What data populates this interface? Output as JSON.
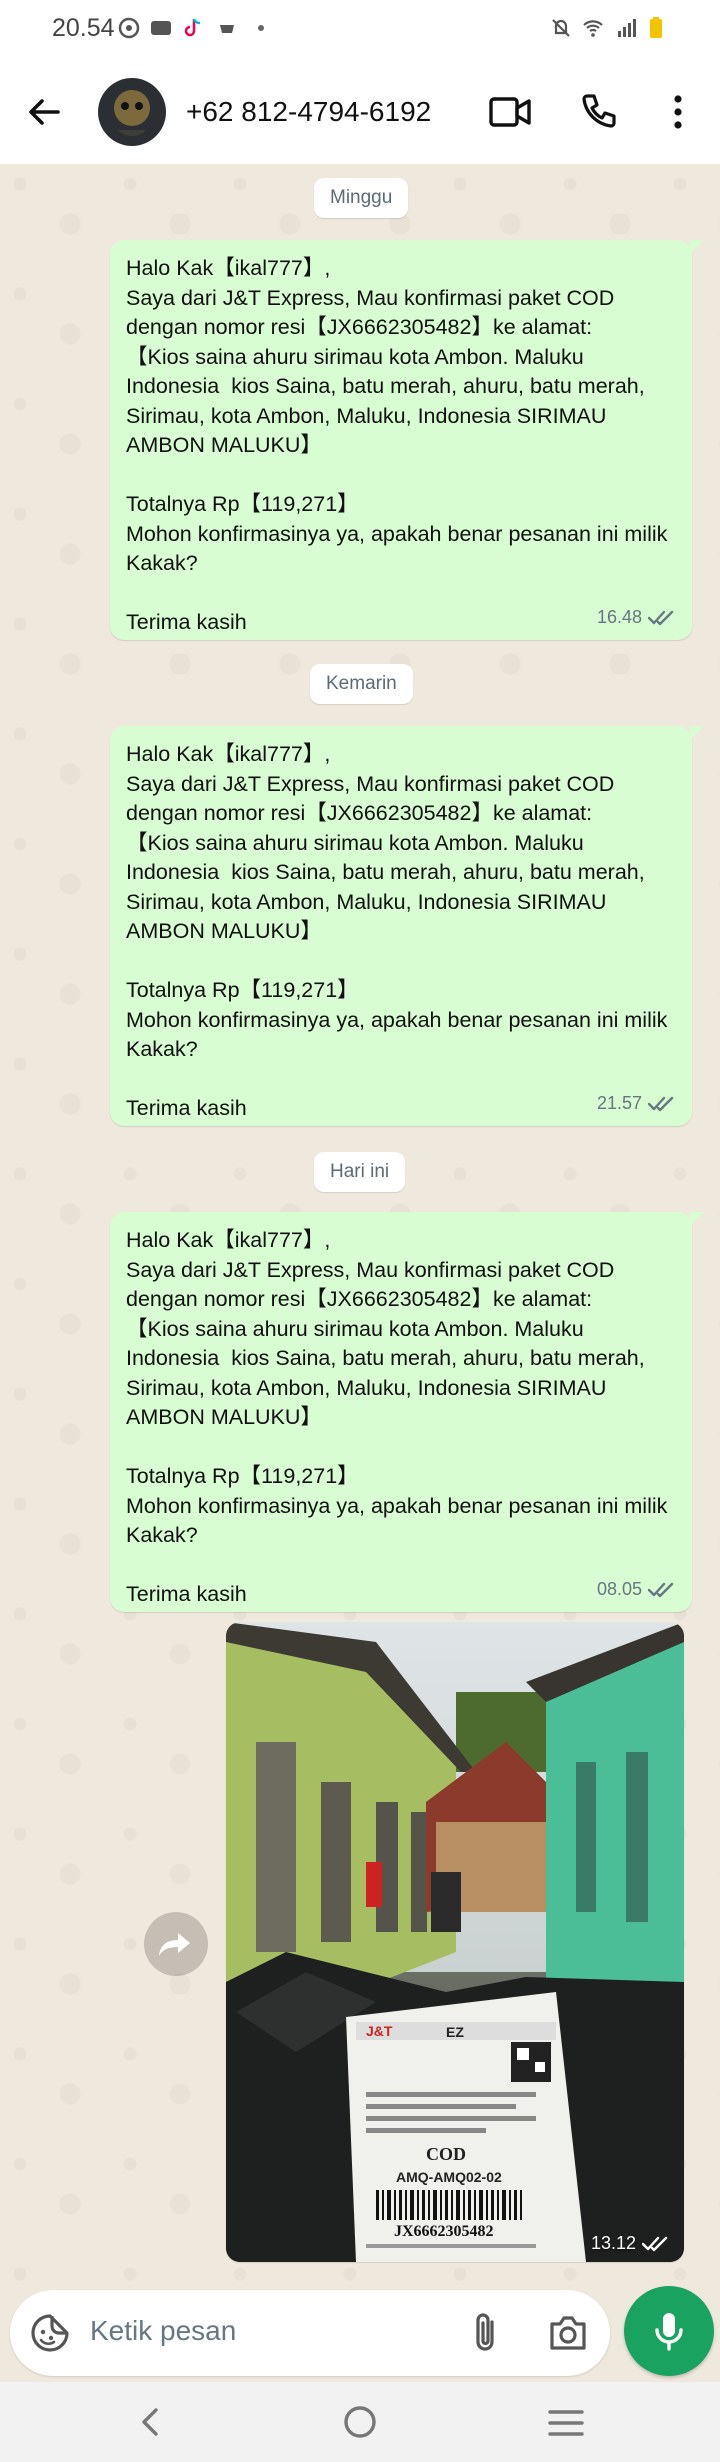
{
  "status_bar": {
    "time": "20.54",
    "icons": [
      "whatsapp-icon",
      "notification-icon",
      "tiktok-icon",
      "game-icon",
      "dot-icon",
      "mute-icon",
      "wifi-icon",
      "signal-icon",
      "battery-icon"
    ]
  },
  "header": {
    "contact_name": "+62 812-4794-6192",
    "actions": [
      "video-call-icon",
      "phone-call-icon",
      "more-options-icon"
    ]
  },
  "chat": {
    "messages": [
      {
        "day_label": "Minggu",
        "text": "Halo Kak【ikal777】,\nSaya dari J&T Express, Mau konfirmasi paket COD dengan nomor resi【JX6662305482】ke alamat:\n【Kios saina ahuru sirimau kota Ambon. Maluku Indonesia  kios Saina, batu merah, ahuru, batu merah, Sirimau, kota Ambon, Maluku, Indonesia SIRIMAU AMBON MALUKU】\n\nTotalnya Rp【119,271】\nMohon konfirmasinya ya, apakah benar pesanan ini milik Kakak?\n\nTerima kasih",
        "time": "16.48"
      },
      {
        "day_label": "Kemarin",
        "text": "Halo Kak【ikal777】,\nSaya dari J&T Express, Mau konfirmasi paket COD dengan nomor resi【JX6662305482】ke alamat:\n【Kios saina ahuru sirimau kota Ambon. Maluku Indonesia  kios Saina, batu merah, ahuru, batu merah, Sirimau, kota Ambon, Maluku, Indonesia SIRIMAU AMBON MALUKU】\n\nTotalnya Rp【119,271】\nMohon konfirmasinya ya, apakah benar pesanan ini milik Kakak?\n\nTerima kasih",
        "time": "21.57"
      },
      {
        "day_label": "Hari ini",
        "text": "Halo Kak【ikal777】,\nSaya dari J&T Express, Mau konfirmasi paket COD dengan nomor resi【JX6662305482】ke alamat:\n【Kios saina ahuru sirimau kota Ambon. Maluku Indonesia  kios Saina, batu merah, ahuru, batu merah, Sirimau, kota Ambon, Maluku, Indonesia SIRIMAU AMBON MALUKU】\n\nTotalnya Rp【119,271】\nMohon konfirmasinya ya, apakah benar pesanan ini milik Kakak?\n\nTerima kasih",
        "time": "08.05"
      }
    ],
    "photo_message": {
      "time": "13.12",
      "label": {
        "cod": "COD",
        "route": "AMQ-AMQ02-02",
        "tracking": "JX6662305482",
        "brand": "J&T",
        "code": "EZ"
      }
    }
  },
  "input": {
    "placeholder": "Ketik pesan"
  },
  "colors": {
    "outgoing_bubble": "#d8fdd2",
    "chat_background": "#efe8dd",
    "accent_green": "#1aa360",
    "read_ticks": "#667781"
  }
}
